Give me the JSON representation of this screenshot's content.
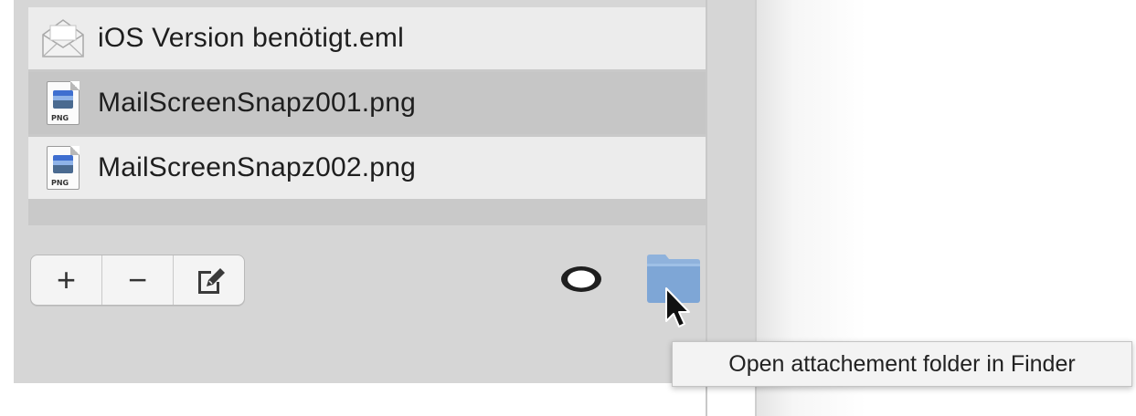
{
  "attachments": {
    "items": [
      {
        "label": "iOS Version benötigt.eml",
        "icon": "email-envelope-icon",
        "selected": false
      },
      {
        "label": "MailScreenSnapz001.png",
        "icon": "png-file-icon",
        "selected": true,
        "badge": "PNG"
      },
      {
        "label": "MailScreenSnapz002.png",
        "icon": "png-file-icon",
        "selected": false,
        "badge": "PNG"
      }
    ]
  },
  "toolbar": {
    "add_label": "+",
    "remove_label": "−",
    "edit_icon": "edit-icon",
    "quicklook_icon": "eye-icon",
    "folder_icon": "folder-icon"
  },
  "tooltip": {
    "text": "Open attachement folder in Finder"
  },
  "colors": {
    "panel": "#d6d6d6",
    "row": "#ececec",
    "row_selected": "#c6c6c6",
    "folder": "#7ea6d6"
  }
}
